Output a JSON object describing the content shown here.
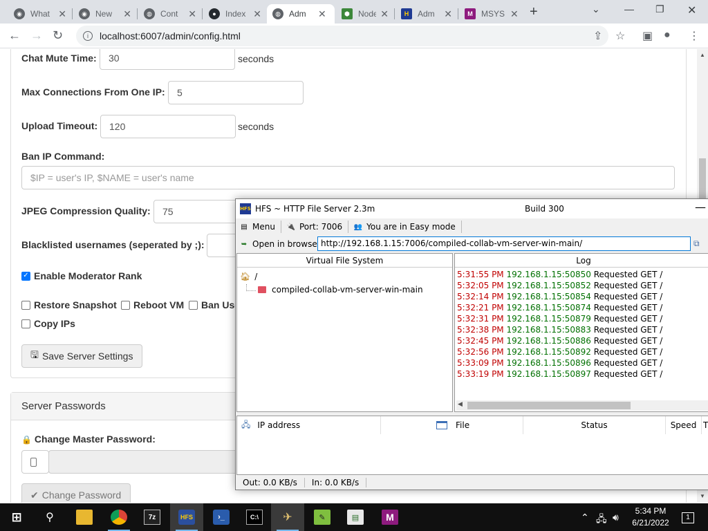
{
  "browser": {
    "tabs": [
      {
        "title": "What",
        "icon": "chrome-icon",
        "color": "#5f6368"
      },
      {
        "title": "New",
        "icon": "chrome-icon",
        "color": "#5f6368"
      },
      {
        "title": "Cont",
        "icon": "globe-icon",
        "color": "#5f6368"
      },
      {
        "title": "Index",
        "icon": "github-icon",
        "color": "#24292e"
      },
      {
        "title": "Adm",
        "icon": "globe-icon",
        "color": "#5f6368"
      },
      {
        "title": "Node",
        "icon": "nodejs-icon",
        "color": "#3c873a"
      },
      {
        "title": "Adm",
        "icon": "hfs-icon",
        "color": "#1f3a93"
      },
      {
        "title": "MSYS",
        "icon": "msys-icon",
        "color": "#8e1b7e"
      }
    ],
    "url": "localhost:6007/admin/config.html"
  },
  "config": {
    "chat_mute_label": "Chat Mute Time:",
    "chat_mute_value": "30",
    "seconds": "seconds",
    "max_conn_label": "Max Connections From One IP:",
    "max_conn_value": "5",
    "upload_timeout_label": "Upload Timeout:",
    "upload_timeout_value": "120",
    "ban_ip_label": "Ban IP Command:",
    "ban_ip_placeholder": "$IP = user's IP, $NAME = user's name",
    "jpeg_label": "JPEG Compression Quality:",
    "jpeg_value": "75",
    "blacklist_label": "Blacklisted usernames (seperated by ;):",
    "enable_mod_label": "Enable Moderator Rank",
    "enable_mod_checked": true,
    "restore_snapshot_label": "Restore Snapshot",
    "reboot_vm_label": "Reboot VM",
    "ban_user_label": "Ban Use",
    "copy_ips_label": "Copy IPs",
    "save_button": "Save Server Settings",
    "passwords_header": "Server Passwords",
    "change_master_label": "Change Master Password:",
    "change_password_button": "Change Password"
  },
  "hfs": {
    "title": "HFS ~ HTTP File Server 2.3m",
    "build": "Build 300",
    "menu": "Menu",
    "port": "Port: 7006",
    "mode": "You are in Easy mode",
    "open_browser": "Open in browser",
    "url": "http://192.168.1.15:7006/compiled-collab-vm-server-win-main/",
    "vfs_header": "Virtual File System",
    "vfs_root": "/",
    "vfs_folder": "compiled-collab-vm-server-win-main",
    "log_header": "Log",
    "log": [
      {
        "time": "5:31:55 PM",
        "addr": "192.168.1.15:50850",
        "msg": "Requested GET /"
      },
      {
        "time": "5:32:05 PM",
        "addr": "192.168.1.15:50852",
        "msg": "Requested GET /"
      },
      {
        "time": "5:32:14 PM",
        "addr": "192.168.1.15:50854",
        "msg": "Requested GET /"
      },
      {
        "time": "5:32:21 PM",
        "addr": "192.168.1.15:50874",
        "msg": "Requested GET /"
      },
      {
        "time": "5:32:31 PM",
        "addr": "192.168.1.15:50879",
        "msg": "Requested GET /"
      },
      {
        "time": "5:32:38 PM",
        "addr": "192.168.1.15:50883",
        "msg": "Requested GET /"
      },
      {
        "time": "5:32:45 PM",
        "addr": "192.168.1.15:50886",
        "msg": "Requested GET /"
      },
      {
        "time": "5:32:56 PM",
        "addr": "192.168.1.15:50892",
        "msg": "Requested GET /"
      },
      {
        "time": "5:33:09 PM",
        "addr": "192.168.1.15:50896",
        "msg": "Requested GET /"
      },
      {
        "time": "5:33:19 PM",
        "addr": "192.168.1.15:50897",
        "msg": "Requested GET /"
      }
    ],
    "columns": {
      "ip": "IP address",
      "file": "File",
      "status": "Status",
      "speed": "Speed",
      "t": "T"
    },
    "out": "Out: 0.0 KB/s",
    "in": "In: 0.0 KB/s"
  },
  "taskbar": {
    "time": "5:34 PM",
    "date": "6/21/2022",
    "notifications": "1"
  }
}
